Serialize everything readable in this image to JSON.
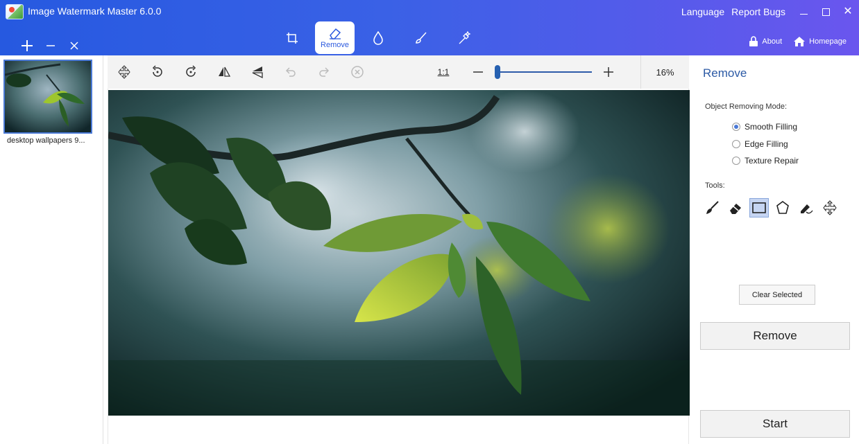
{
  "app": {
    "title": "Image Watermark Master 6.0.0",
    "accent_color": "#2c5ade"
  },
  "topbar": {
    "language": "Language",
    "report_bugs": "Report Bugs",
    "about": "About",
    "homepage": "Homepage"
  },
  "modes": [
    {
      "icon": "crop-icon",
      "label": ""
    },
    {
      "icon": "eraser-icon",
      "label": "Remove",
      "active": true
    },
    {
      "icon": "drop-icon",
      "label": ""
    },
    {
      "icon": "brush-icon",
      "label": ""
    },
    {
      "icon": "magic-wand-icon",
      "label": ""
    }
  ],
  "files": [
    {
      "name": "desktop wallpapers 9..."
    }
  ],
  "toolbar": {
    "ratio_label": "1:1",
    "zoom_value": "16%",
    "zoom_level": 0.0
  },
  "panel": {
    "title": "Remove",
    "mode_label": "Object Removing Mode:",
    "options": [
      {
        "label": "Smooth Filling",
        "selected": true
      },
      {
        "label": "Edge Filling",
        "selected": false
      },
      {
        "label": "Texture Repair",
        "selected": false
      }
    ],
    "tools_label": "Tools:",
    "tools": [
      "brush-icon",
      "eraser-icon",
      "rectangle-select-icon",
      "polygon-select-icon",
      "pen-lasso-icon",
      "move-icon"
    ],
    "selected_tool": "rectangle-select-icon",
    "clear_selected": "Clear Selected",
    "remove": "Remove",
    "start": "Start"
  }
}
